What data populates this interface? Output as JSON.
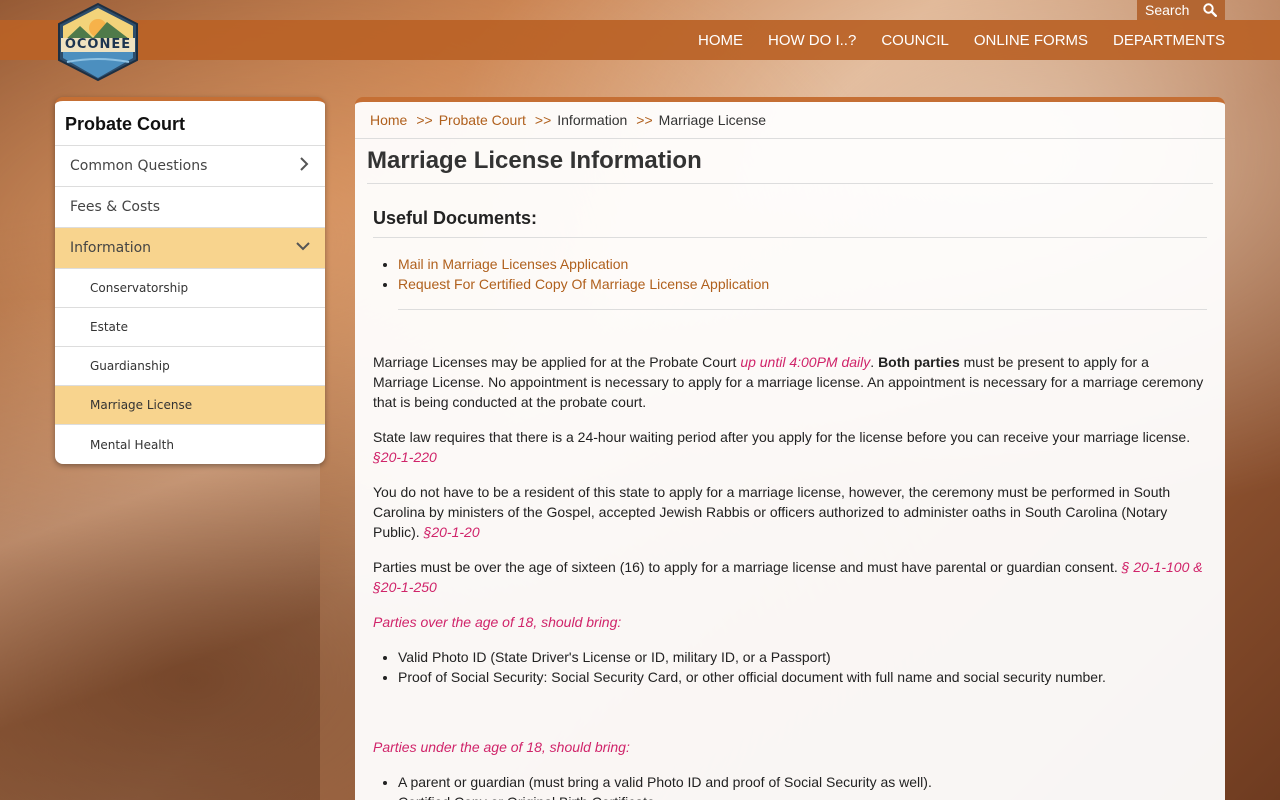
{
  "header": {
    "logo_text": "OCONEE",
    "search_label": "Search",
    "nav": [
      "HOME",
      "HOW DO I..?",
      "COUNCIL",
      "ONLINE FORMS",
      "DEPARTMENTS"
    ]
  },
  "sidebar": {
    "title": "Probate Court",
    "items": [
      {
        "label": "Common Questions"
      },
      {
        "label": "Fees & Costs"
      },
      {
        "label": "Information"
      }
    ],
    "subitems": [
      {
        "label": "Conservatorship"
      },
      {
        "label": "Estate"
      },
      {
        "label": "Guardianship"
      },
      {
        "label": "Marriage License"
      },
      {
        "label": "Mental Health"
      }
    ]
  },
  "breadcrumb": {
    "home": "Home",
    "probate": "Probate Court",
    "information": "Information",
    "current": "Marriage License",
    "sep": ">>"
  },
  "main": {
    "title": "Marriage License Information",
    "docs_title": "Useful Documents:",
    "docs": [
      "Mail in Marriage Licenses Application",
      "Request For Certified Copy Of Marriage License Application"
    ],
    "p1_a": "Marriage Licenses may be applied for at the Probate Court ",
    "p1_b": "up until 4:00PM daily",
    "p1_c": ". ",
    "p1_d": "Both parties",
    "p1_e": " must be present to apply for a Marriage License. No appointment is necessary to apply for a marriage license. An appointment is necessary for a marriage ceremony that is being conducted at the probate court.",
    "p2_a": "State law requires that there is a 24-hour waiting period after you apply for the license before you can receive your marriage license. ",
    "p2_b": "§20-1-220",
    "p3_a": "You do not have to be a resident of this state to apply for a marriage license, however, the ceremony must be performed in South Carolina by ministers of the Gospel, accepted Jewish Rabbis or officers authorized to administer oaths in South Carolina (Notary Public). ",
    "p3_b": "§20-1-20",
    "p4_a": "Parties must be over the age of sixteen (16) to apply for a marriage license and must have parental or guardian consent. ",
    "p4_b": "§ 20-1-100 & §20-1-250",
    "over18_title": "Parties over the age of 18, should bring:",
    "over18": [
      "Valid Photo ID (State Driver's License or ID, military ID, or a Passport)",
      "Proof of Social Security: Social Security Card, or other official document with full name and social security number."
    ],
    "under18_title": "Parties under the age of 18, should bring:",
    "under18": [
      "A parent or guardian (must bring a valid Photo ID and proof of Social Security as well).",
      "Certified Copy or Original Birth Certificate"
    ]
  },
  "colors": {
    "accent": "#c56f34",
    "link": "#b0601d",
    "highlight": "#f8d48e",
    "emphasis": "#d0246a"
  }
}
